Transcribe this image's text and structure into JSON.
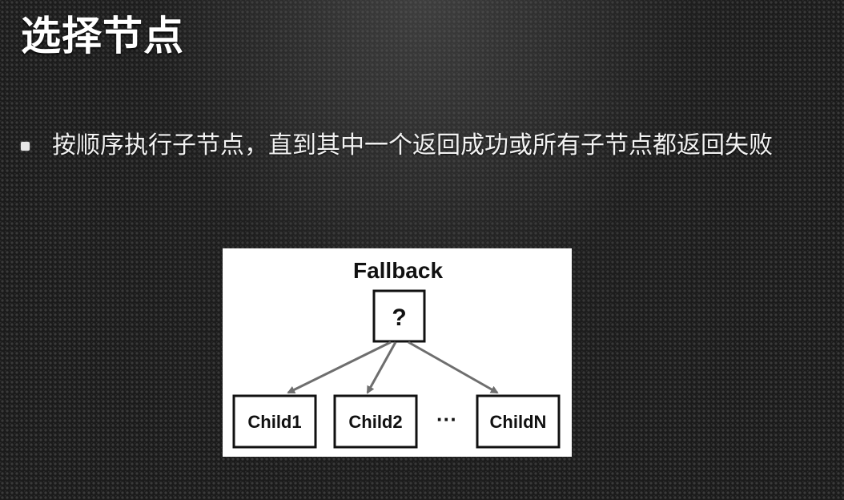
{
  "slide": {
    "title": "选择节点",
    "bullet": "按顺序执行子节点，直到其中一个返回成功或所有子节点都返回失败"
  },
  "diagram": {
    "title": "Fallback",
    "root_symbol": "?",
    "children": [
      "Child1",
      "Child2",
      "ChildN"
    ],
    "ellipsis": "···",
    "colors": {
      "box_border": "#111111",
      "arrow": "#6e6e6e",
      "background": "#ffffff"
    }
  }
}
